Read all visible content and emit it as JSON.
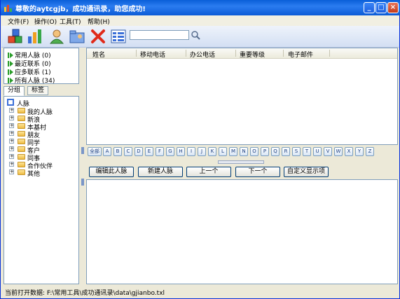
{
  "window": {
    "title": "尊敬的aytcgjb，成功通讯录，助您成功!",
    "controls": [
      "minimize",
      "maximize",
      "close"
    ]
  },
  "menu": [
    {
      "label": "文件(F)"
    },
    {
      "label": "操作(O)"
    },
    {
      "label": "工具(T)"
    },
    {
      "label": "帮助(H)"
    }
  ],
  "toolbar": {
    "tools": [
      "cubes-icon",
      "bar-chart-icon",
      "user-icon",
      "folder-user-icon",
      "delete-x-icon",
      "grid-view-icon"
    ],
    "search_value": "",
    "search_icon": "search-icon"
  },
  "quick": [
    {
      "label": "常用人脉 (0)"
    },
    {
      "label": "最近联系 (0)"
    },
    {
      "label": "应多联系 (1)"
    },
    {
      "label": "所有人脉 (34)"
    }
  ],
  "tabs": [
    {
      "label": "分组"
    },
    {
      "label": "标签"
    }
  ],
  "tree": {
    "root": "人脉",
    "groups": [
      "我的人脉",
      "新浪",
      "本基村",
      "朋友",
      "同学",
      "客户",
      "同事",
      "合作伙伴",
      "其他"
    ]
  },
  "grid": {
    "columns": [
      "姓名",
      "移动电话",
      "办公电话",
      "重要等级",
      "电子邮件"
    ]
  },
  "alphabet": {
    "all_label": "全部",
    "letters": [
      "A",
      "B",
      "C",
      "D",
      "E",
      "F",
      "G",
      "H",
      "I",
      "J",
      "K",
      "L",
      "M",
      "N",
      "O",
      "P",
      "Q",
      "R",
      "S",
      "T",
      "U",
      "V",
      "W",
      "X",
      "Y",
      "Z"
    ]
  },
  "actions": {
    "edit": "编辑此人脉",
    "new": "新建人脉",
    "prev": "上一个",
    "next": "下一个",
    "custom": "自定义显示项"
  },
  "status": {
    "text": "当前打开数据: F:\\常用工具\\成功通讯录\\data\\gjianbo.txl"
  },
  "colors": {
    "title_bar": "#0a5fd8",
    "accent": "#7f9db9",
    "folder": "#eebc43",
    "quick_arrow": "#2a9d2a"
  }
}
